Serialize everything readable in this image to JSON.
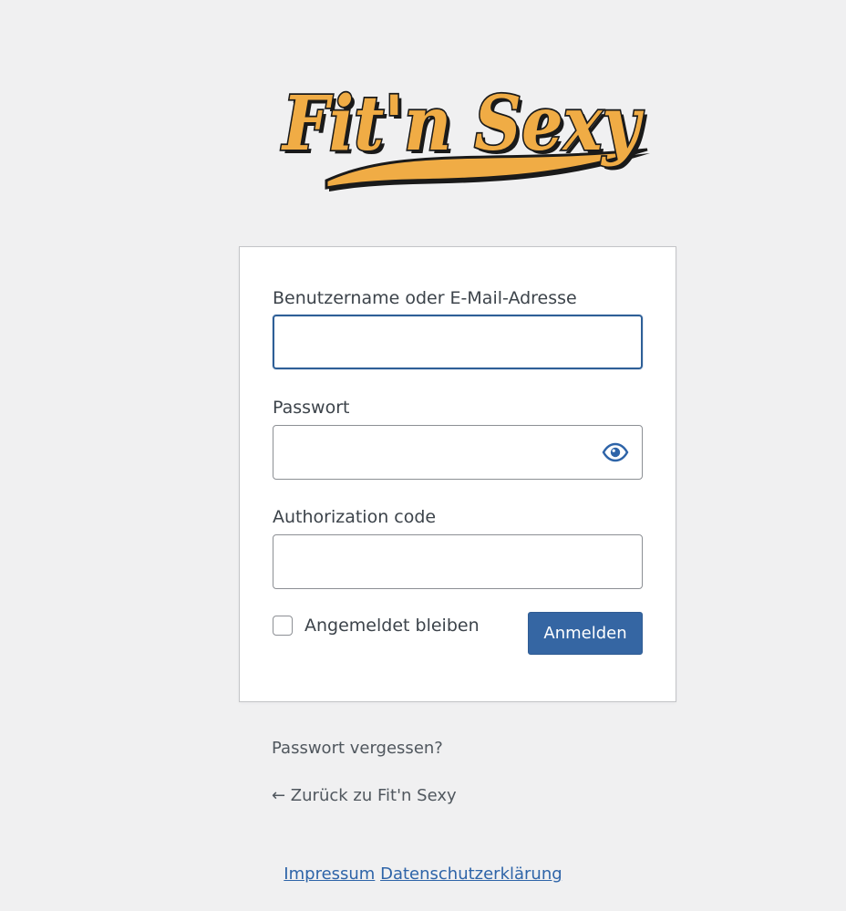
{
  "logo": {
    "text": "Fit'n Sexy",
    "colors": {
      "fill": "#f0ac45",
      "outline": "#1a1a1a"
    }
  },
  "form": {
    "username": {
      "label": "Benutzername oder E-Mail-Adresse",
      "value": ""
    },
    "password": {
      "label": "Passwort",
      "value": "",
      "toggle_icon": "eye-icon"
    },
    "authcode": {
      "label": "Authorization code",
      "value": ""
    },
    "remember": {
      "label": "Angemeldet bleiben",
      "checked": false
    },
    "submit_label": "Anmelden"
  },
  "links": {
    "lost_password": "Passwort vergessen?",
    "back_to_site": "← Zurück zu Fit'n Sexy"
  },
  "footer": {
    "impressum": "Impressum",
    "privacy": "Datenschutzerklärung"
  },
  "colors": {
    "background": "#f0f0f1",
    "accent": "#3566a3",
    "link": "#2e64a8"
  }
}
